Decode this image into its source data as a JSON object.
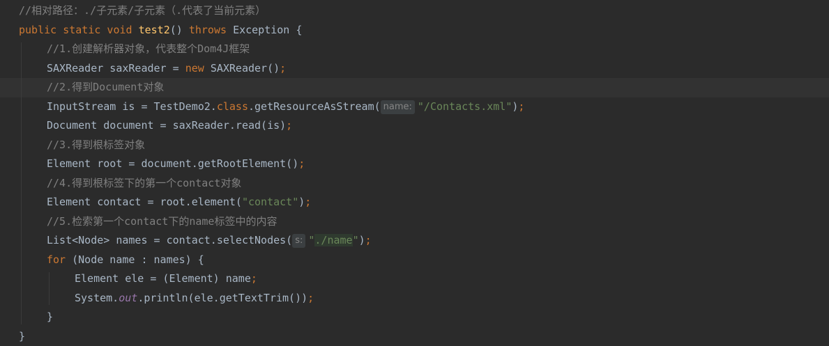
{
  "editor": {
    "lines": [
      {
        "indent": 0,
        "tokens": [
          {
            "text": "//相对路径：./子元素/子元素（.代表了当前元素）",
            "type": "comment"
          }
        ]
      },
      {
        "indent": 0,
        "tokens": [
          {
            "text": "public static void ",
            "type": "keyword"
          },
          {
            "text": "test2",
            "type": "method"
          },
          {
            "text": "() ",
            "type": "plain"
          },
          {
            "text": "throws ",
            "type": "keyword"
          },
          {
            "text": "Exception {",
            "type": "plain"
          }
        ]
      },
      {
        "indent": 1,
        "tokens": [
          {
            "text": "//1.创建解析器对象，代表整个Dom4J框架",
            "type": "comment"
          }
        ]
      },
      {
        "indent": 1,
        "tokens": [
          {
            "text": "SAXReader saxReader = ",
            "type": "plain"
          },
          {
            "text": "new ",
            "type": "keyword"
          },
          {
            "text": "SAXReader()",
            "type": "plain"
          },
          {
            "text": ";",
            "type": "keyword"
          }
        ]
      },
      {
        "indent": 1,
        "current": true,
        "tokens": [
          {
            "text": "//2.得到Document对象",
            "type": "comment"
          }
        ]
      },
      {
        "indent": 1,
        "tokens": [
          {
            "text": "InputStream is = TestDemo2.",
            "type": "plain"
          },
          {
            "text": "class",
            "type": "keyword"
          },
          {
            "text": ".getResourceAsStream(",
            "type": "plain"
          },
          {
            "text": "name:",
            "type": "hint"
          },
          {
            "text": "\"/Contacts.xml\"",
            "type": "string"
          },
          {
            "text": ")",
            "type": "plain"
          },
          {
            "text": ";",
            "type": "keyword"
          }
        ]
      },
      {
        "indent": 1,
        "tokens": [
          {
            "text": "Document document = saxReader.read(is)",
            "type": "plain"
          },
          {
            "text": ";",
            "type": "keyword"
          }
        ]
      },
      {
        "indent": 1,
        "tokens": [
          {
            "text": "//3.得到根标签对象",
            "type": "comment"
          }
        ]
      },
      {
        "indent": 1,
        "tokens": [
          {
            "text": "Element root = document.getRootElement()",
            "type": "plain"
          },
          {
            "text": ";",
            "type": "keyword"
          }
        ]
      },
      {
        "indent": 1,
        "tokens": [
          {
            "text": "//4.得到根标签下的第一个contact对象",
            "type": "comment"
          }
        ]
      },
      {
        "indent": 1,
        "tokens": [
          {
            "text": "Element contact = root.element(",
            "type": "plain"
          },
          {
            "text": "\"contact\"",
            "type": "string"
          },
          {
            "text": ")",
            "type": "plain"
          },
          {
            "text": ";",
            "type": "keyword"
          }
        ]
      },
      {
        "indent": 1,
        "tokens": [
          {
            "text": "//5.检索第一个contact下的name标签中的内容",
            "type": "comment"
          }
        ]
      },
      {
        "indent": 1,
        "tokens": [
          {
            "text": "List<Node> names = contact.selectNodes(",
            "type": "plain"
          },
          {
            "text": "s:",
            "type": "hint"
          },
          {
            "text": "\"",
            "type": "string"
          },
          {
            "text": "./name",
            "type": "string-hl"
          },
          {
            "text": "\"",
            "type": "string"
          },
          {
            "text": ")",
            "type": "plain"
          },
          {
            "text": ";",
            "type": "keyword"
          }
        ]
      },
      {
        "indent": 1,
        "tokens": [
          {
            "text": "for ",
            "type": "keyword"
          },
          {
            "text": "(Node name : names) {",
            "type": "plain"
          }
        ]
      },
      {
        "indent": 2,
        "tokens": [
          {
            "text": "Element ele = (Element) name",
            "type": "plain"
          },
          {
            "text": ";",
            "type": "keyword"
          }
        ]
      },
      {
        "indent": 2,
        "tokens": [
          {
            "text": "System.",
            "type": "plain"
          },
          {
            "text": "out",
            "type": "field"
          },
          {
            "text": ".println(ele.getTextTrim())",
            "type": "plain"
          },
          {
            "text": ";",
            "type": "keyword"
          }
        ]
      },
      {
        "indent": 1,
        "tokens": [
          {
            "text": "}",
            "type": "plain"
          }
        ]
      },
      {
        "indent": 0,
        "tokens": [
          {
            "text": "}",
            "type": "plain"
          }
        ]
      }
    ]
  },
  "colors": {
    "background": "#2b2b2b",
    "current_line": "#323232",
    "comment": "#808080",
    "keyword": "#cc7832",
    "method": "#ffc66d",
    "string": "#6a8759",
    "field": "#9876aa",
    "plain": "#a9b7c6",
    "hint_bg": "#3b3f41",
    "hint_text": "#858585"
  }
}
